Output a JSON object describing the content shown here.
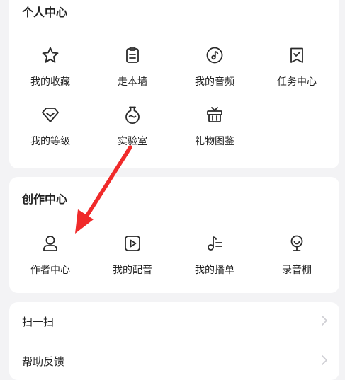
{
  "personal": {
    "title": "个人中心",
    "items": [
      {
        "label": "我的收藏",
        "icon": "star-icon"
      },
      {
        "label": "走本墙",
        "icon": "clipboard-icon"
      },
      {
        "label": "我的音频",
        "icon": "music-note-icon"
      },
      {
        "label": "任务中心",
        "icon": "task-check-icon"
      },
      {
        "label": "我的等级",
        "icon": "gem-level-icon"
      },
      {
        "label": "实验室",
        "icon": "flask-icon"
      },
      {
        "label": "礼物图鉴",
        "icon": "gift-icon"
      }
    ]
  },
  "creation": {
    "title": "创作中心",
    "items": [
      {
        "label": "作者中心",
        "icon": "person-icon"
      },
      {
        "label": "我的配音",
        "icon": "play-button-icon"
      },
      {
        "label": "我的播单",
        "icon": "playlist-note-icon"
      },
      {
        "label": "录音棚",
        "icon": "microphone-icon"
      }
    ]
  },
  "list": {
    "items": [
      {
        "label": "扫一扫",
        "icon": "chevron-right-icon"
      },
      {
        "label": "帮助反馈",
        "icon": "chevron-right-icon"
      }
    ]
  },
  "annotation": {
    "color": "#f02a2a",
    "icon": "red-arrow-pointing-to-author-center"
  }
}
